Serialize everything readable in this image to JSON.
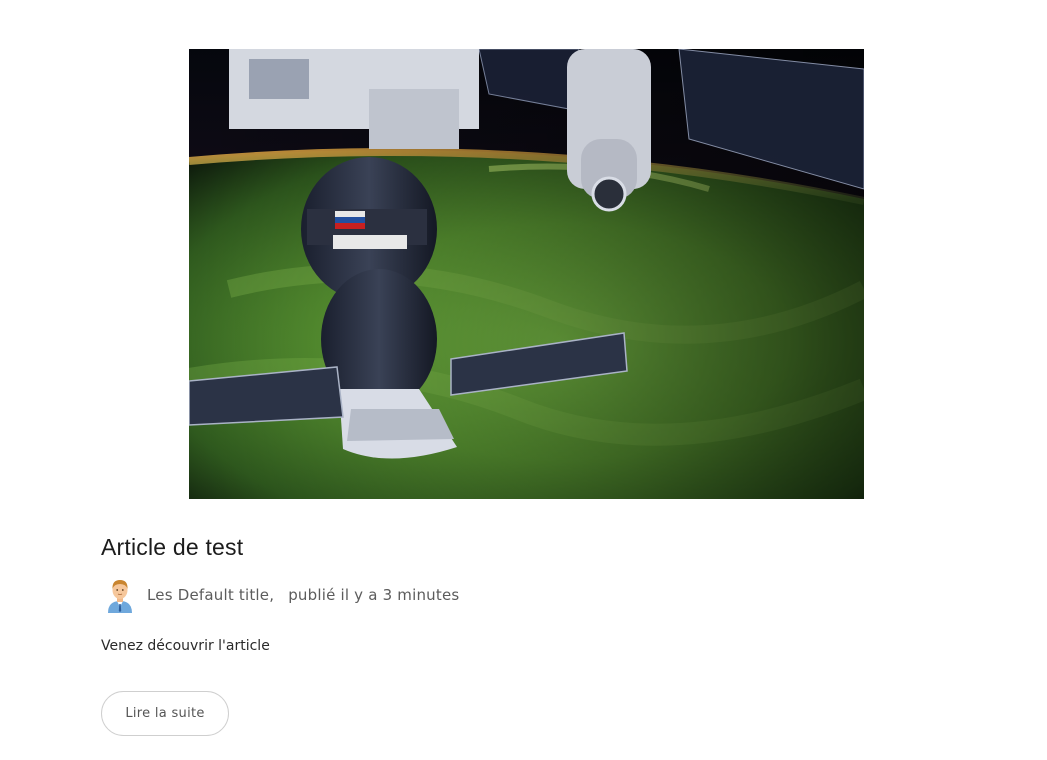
{
  "article": {
    "image_alt": "Soyuz spacecraft docked to the International Space Station above green aurora",
    "title": "Article de test",
    "author": "Les Default title,",
    "published": "publié il y a 3 minutes",
    "excerpt": "Venez découvrir l'article",
    "read_more_label": "Lire la suite"
  },
  "colors": {
    "title": "#1c1c1c",
    "meta": "#5c5c5c",
    "button_border": "#cfcfcf",
    "aurora_green": "#6fbf3a"
  },
  "icons": {
    "avatar": "user-avatar-icon"
  }
}
